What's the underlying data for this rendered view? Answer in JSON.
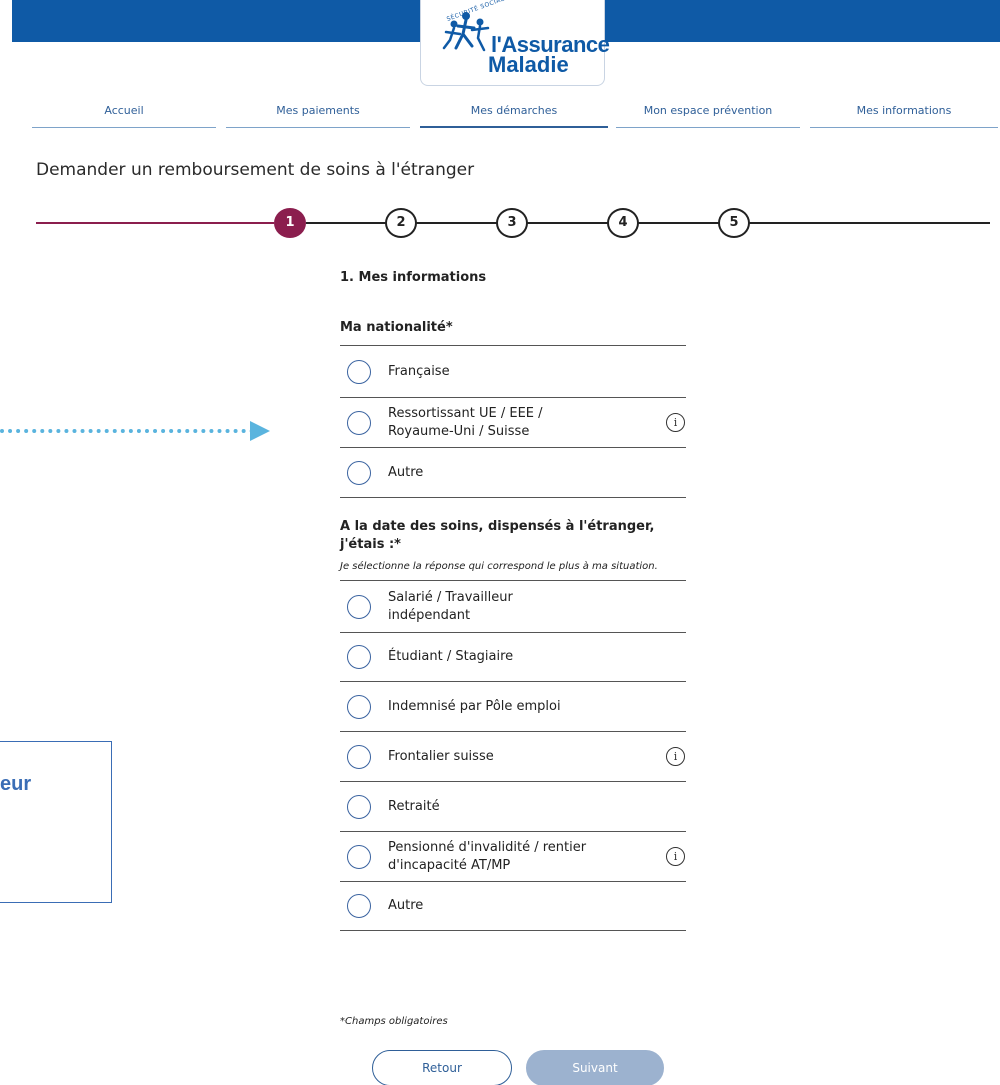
{
  "logo": {
    "small_text": "SÉCURITÉ SOCIALE",
    "line1": "l'Assurance",
    "line2": "Maladie",
    "brand_color": "#0f5aa6"
  },
  "nav": {
    "items": [
      {
        "label": "Accueil"
      },
      {
        "label": "Mes paiements"
      },
      {
        "label": "Mes démarches",
        "active": true
      },
      {
        "label": "Mon espace prévention"
      },
      {
        "label": "Mes informations"
      }
    ]
  },
  "page_title": "Demander un remboursement de soins à l'étranger",
  "stepper": {
    "steps": [
      "1",
      "2",
      "3",
      "4",
      "5"
    ],
    "current": 1,
    "active_color": "#8b1e4e"
  },
  "form": {
    "section_title": "1. Mes informations",
    "nationality": {
      "title": "Ma nationalité*",
      "options": [
        {
          "label": "Française",
          "info": false
        },
        {
          "label": "Ressortissant UE / EEE / Royaume-Uni / Suisse",
          "info": true
        },
        {
          "label": "Autre",
          "info": false
        }
      ]
    },
    "status": {
      "title": "A la date des soins, dispensés à l'étranger, j'étais :*",
      "hint": "Je sélectionne la réponse qui correspond le plus à ma situation.",
      "options": [
        {
          "label": "Salarié / Travailleur indépendant",
          "info": false
        },
        {
          "label": "Étudiant / Stagiaire",
          "info": false
        },
        {
          "label": "Indemnisé par Pôle emploi",
          "info": false
        },
        {
          "label": "Frontalier suisse",
          "info": true
        },
        {
          "label": "Retraité",
          "info": false
        },
        {
          "label": "Pensionné d'invalidité / rentier d'incapacité AT/MP",
          "info": true
        },
        {
          "label": "Autre",
          "info": false
        }
      ]
    },
    "required_note": "*Champs obligatoires",
    "back_label": "Retour",
    "next_label": "Suivant"
  },
  "annotation": {
    "callout_text": "eur",
    "accent_color": "#5ab4de"
  },
  "icons": {
    "info": "i"
  }
}
